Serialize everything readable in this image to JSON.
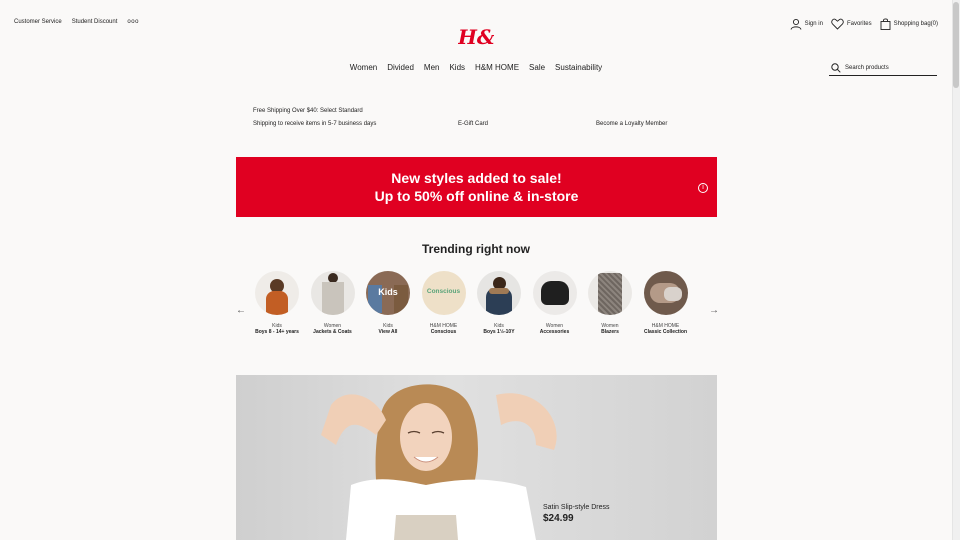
{
  "header": {
    "top_links": [
      "Customer Service",
      "Student Discount"
    ],
    "more": "ooo",
    "logo_text": "H&M",
    "sign_in": "Sign in",
    "favorites": "Favorites",
    "shopping_bag": "Shopping bag(0)"
  },
  "nav": {
    "items": [
      "Women",
      "Divided",
      "Men",
      "Kids",
      "H&M HOME",
      "Sale",
      "Sustainability"
    ]
  },
  "search": {
    "placeholder": "Search products"
  },
  "promo_strip": {
    "shipping": "Free Shipping Over $40: Select Standard Shipping to receive items in 5-7 business days",
    "gift_card": "E-Gift Card",
    "loyalty": "Become a Loyalty Member"
  },
  "banner": {
    "line1": "New styles added to sale!",
    "line2": "Up to 50% off online & in-store",
    "info_icon": "info-icon"
  },
  "trending": {
    "title": "Trending right now",
    "items": [
      {
        "category": "Kids",
        "label": "Boys 8 - 14+ years",
        "img_text": ""
      },
      {
        "category": "Women",
        "label": "Jackets & Coats",
        "img_text": ""
      },
      {
        "category": "Kids",
        "label": "View All",
        "img_text": "Kids"
      },
      {
        "category": "H&M HOME",
        "label": "Conscious",
        "img_text": "Conscious"
      },
      {
        "category": "Kids",
        "label": "Boys 1½-10Y",
        "img_text": ""
      },
      {
        "category": "Women",
        "label": "Accessories",
        "img_text": ""
      },
      {
        "category": "Women",
        "label": "Blazers",
        "img_text": ""
      },
      {
        "category": "H&M HOME",
        "label": "Classic Collection",
        "img_text": ""
      }
    ]
  },
  "hero": {
    "product_name": "Satin Slip-style Dress",
    "price": "$24.99"
  },
  "colors": {
    "brand_red": "#e00021",
    "background": "#faf9f8"
  }
}
